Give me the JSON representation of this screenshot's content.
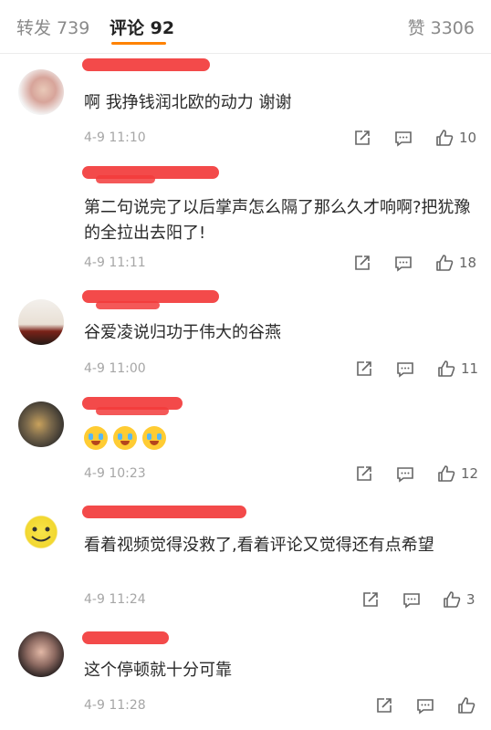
{
  "tabs": {
    "repost": "转发 739",
    "comments": "评论 92",
    "likes": "赞 3306"
  },
  "comments": [
    {
      "text": "啊 我挣钱润北欧的动力 谢谢",
      "time": "4-9 11:10",
      "like_count": "10"
    },
    {
      "text": "第二句说完了以后掌声怎么隔了那么久才响啊?把犹豫的全拉出去阳了!",
      "time": "4-9 11:11",
      "like_count": "18"
    },
    {
      "text": "谷爱凌说归功于伟大的谷燕",
      "time": "4-9 11:00",
      "like_count": "11"
    },
    {
      "text": "",
      "time": "4-9 10:23",
      "like_count": "12"
    },
    {
      "text": "看着视频觉得没救了,看着评论又觉得还有点希望",
      "time": "4-9 11:24",
      "like_count": "3"
    },
    {
      "text": "这个停顿就十分可靠",
      "time": "4-9 11:28",
      "like_count": ""
    }
  ],
  "colors": {
    "accent": "#ff8200",
    "redaction": "#f23b3b"
  },
  "icons": [
    "share-icon",
    "comment-icon",
    "thumbs-up-icon",
    "crying-laughing-emoji"
  ]
}
